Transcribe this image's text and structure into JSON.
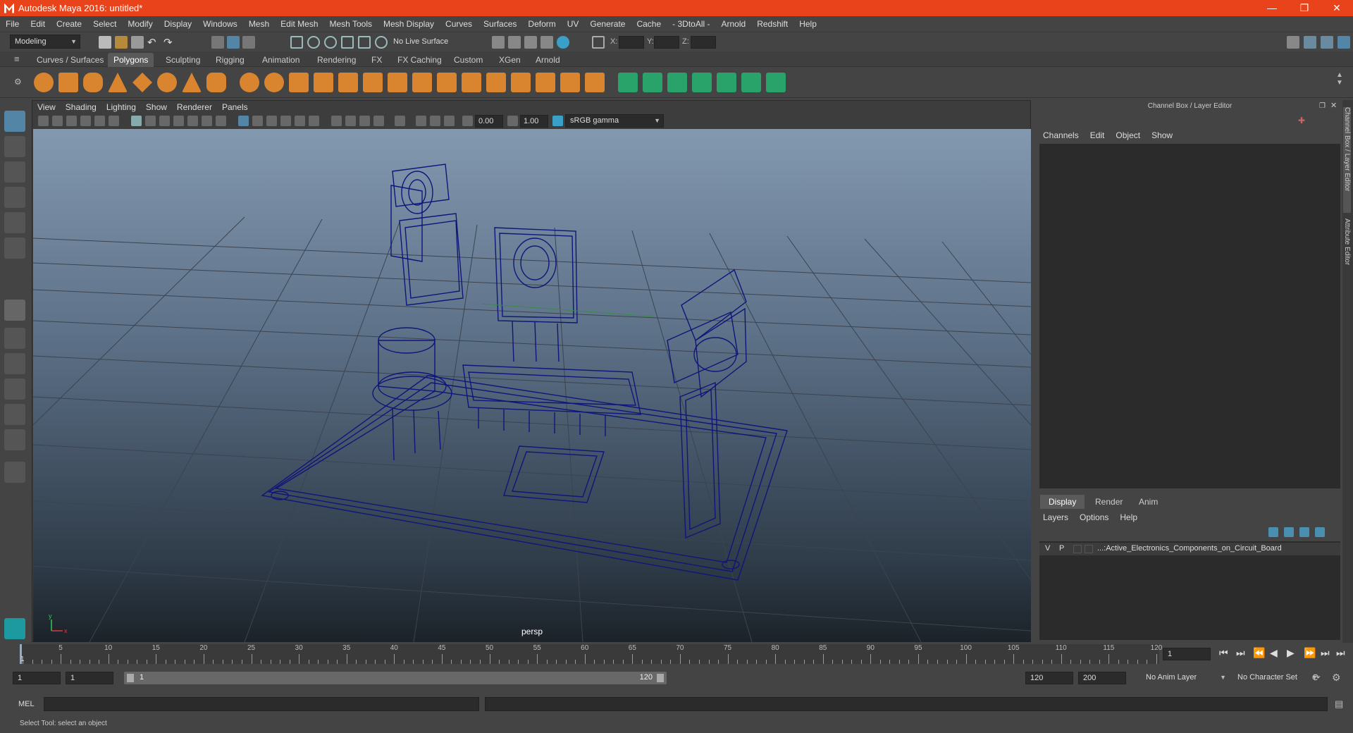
{
  "window": {
    "title": "Autodesk Maya 2016: untitled*",
    "controls": [
      "—",
      "❐",
      "✕"
    ]
  },
  "menubar": [
    "File",
    "Edit",
    "Create",
    "Select",
    "Modify",
    "Display",
    "Windows",
    "Mesh",
    "Edit Mesh",
    "Mesh Tools",
    "Mesh Display",
    "Curves",
    "Surfaces",
    "Deform",
    "UV",
    "Generate",
    "Cache",
    "- 3DtoAll -",
    "Arnold",
    "Redshift",
    "Help"
  ],
  "status": {
    "workspace_menu": "Modeling",
    "live_surface": "No Live Surface",
    "x_label": "X:",
    "y_label": "Y:",
    "z_label": "Z:"
  },
  "shelf_tabs": [
    "Curves / Surfaces",
    "Polygons",
    "Sculpting",
    "Rigging",
    "Animation",
    "Rendering",
    "FX",
    "FX Caching",
    "Custom",
    "XGen",
    "Arnold"
  ],
  "shelf_active": "Polygons",
  "viewport": {
    "menu": [
      "View",
      "Shading",
      "Lighting",
      "Show",
      "Renderer",
      "Panels"
    ],
    "exposure": "0.00",
    "gamma": "1.00",
    "color_space": "sRGB gamma",
    "camera": "persp",
    "axis_x": "x",
    "axis_y": "y"
  },
  "channel_box": {
    "title": "Channel Box / Layer Editor",
    "menu": [
      "Channels",
      "Edit",
      "Object",
      "Show"
    ]
  },
  "layer_editor": {
    "tabs": [
      "Display",
      "Render",
      "Anim"
    ],
    "active_tab": "Display",
    "menu": [
      "Layers",
      "Options",
      "Help"
    ],
    "layer": {
      "v": "V",
      "p": "P",
      "name": "...:Active_Electronics_Components_on_Circuit_Board"
    }
  },
  "side_tabs": [
    "Channel Box / Layer Editor",
    "Attribute Editor"
  ],
  "timeline": {
    "ticks": [
      5,
      10,
      15,
      20,
      25,
      30,
      35,
      40,
      45,
      50,
      55,
      60,
      65,
      70,
      75,
      80,
      85,
      90,
      95,
      100,
      105,
      110,
      115,
      120
    ],
    "start_label": "1",
    "current_frame": "1"
  },
  "range": {
    "start": "1",
    "playback_start": "1",
    "slider_start": "1",
    "slider_end": "120",
    "playback_end": "120",
    "end": "200",
    "anim_layer": "No Anim Layer",
    "character_set": "No Character Set"
  },
  "command": {
    "label": "MEL"
  },
  "help_line": "Select Tool: select an object",
  "colors": {
    "title_bar": "#e8431a",
    "wireframe": "#10137a",
    "accent": "#5285a6"
  }
}
